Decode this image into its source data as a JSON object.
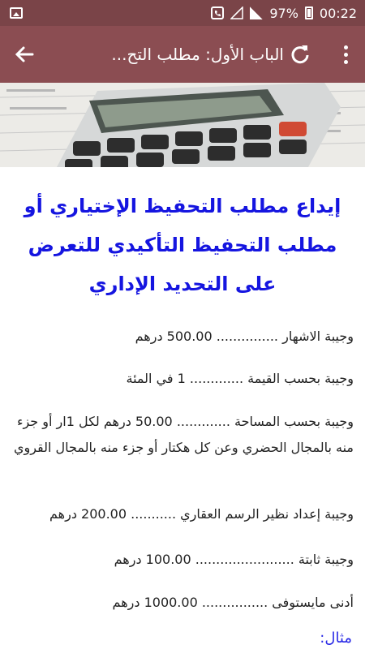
{
  "status_bar": {
    "battery": "97%",
    "time": "00:22"
  },
  "toolbar": {
    "title": "الباب الأول: مطلب التح...",
    "back_icon": "arrow-left-icon",
    "refresh_icon": "refresh-icon",
    "menu_icon": "more-vert-icon"
  },
  "article": {
    "headline": "إيداع مطلب التحفيظ الإختياري أو مطلب التحفيظ التأكيدي للتعرض على التحديد الإداري",
    "lines": [
      "وجيبة الاشهار ............... 500.00 درهم",
      "وجيبة بحسب القيمة ............. 1 في المئة",
      "وجيبة بحسب المساحة ............. 50.00 درهم لكل 1ار أو جزء منه بالمجال الحضري وعن كل هكتار أو جزء منه بالمجال القروي",
      "وجيبة إعداد نظير الرسم العقاري ........... 200.00 درهم",
      "وجيبة ثابتة ........................ 100.00 درهم",
      "أدنى مايستوفى ................ 1000.00 درهم"
    ],
    "example_label": "مثال:"
  },
  "colors": {
    "status_bar": "#7a4448",
    "toolbar": "#8b4d52",
    "headline": "#1515e0"
  }
}
